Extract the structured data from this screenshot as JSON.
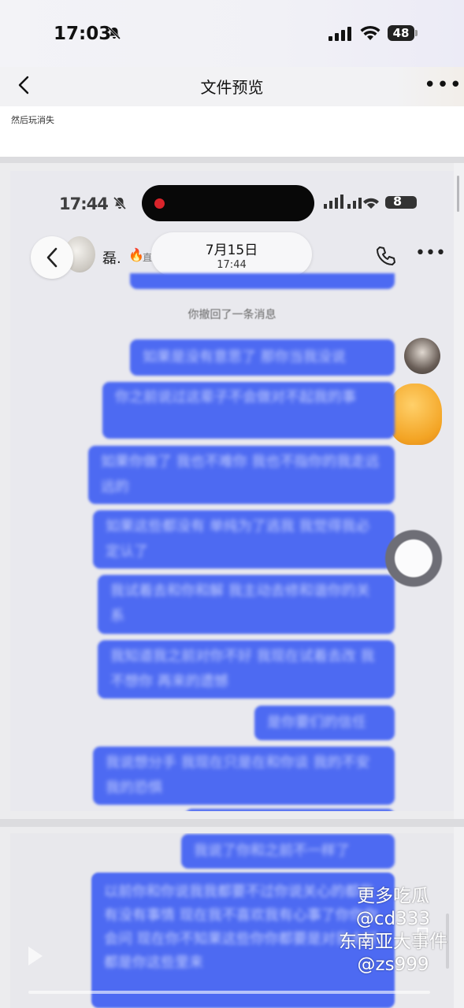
{
  "status_bar": {
    "time": "17:03",
    "battery": "48"
  },
  "nav": {
    "title": "文件预览"
  },
  "top_card": {
    "text": "然后玩消失"
  },
  "shot1": {
    "time": "17:44",
    "battery": "8",
    "contact_name": "磊.",
    "contact_status": "直聊中 2/3",
    "date": "7月15日",
    "date_time": "17:44",
    "recall_notice": "你撤回了一条消息",
    "bubbles": [
      {
        "text": "如果是没有意思了 那你当我没说"
      },
      {
        "text": "你之前说过这辈子不会做对不起我的事"
      },
      {
        "text": "如果你做了 我也不难你 我也不指你的我走远远的"
      },
      {
        "text": "如果这些都没有 单纯为了逃我 我觉得我必定认了"
      },
      {
        "text": "我试着去和你和解 我主动去修和谐你的关系"
      },
      {
        "text": "我知道我之前对你不好 我现在试着去改 我不想你 再来的遗憾"
      },
      {
        "text": "是你要们的信任"
      },
      {
        "text": "我说想分手 我现在只是在和你谈 我的不安 我的恐惧"
      }
    ]
  },
  "shot2": {
    "bubbles": [
      {
        "text": "我说了你和之前不一样了"
      },
      {
        "text": "以前你和你说我我都要不过你说关心的都我有没有事情 现在我不喜欢我有心事了你你你会问 现在你不知果这些你你都要是对我太好 都是你这些里来"
      }
    ],
    "overlay_lines": [
      "更多吃瓜",
      "@cd333",
      "东南亚大事件",
      "@zs999"
    ]
  }
}
